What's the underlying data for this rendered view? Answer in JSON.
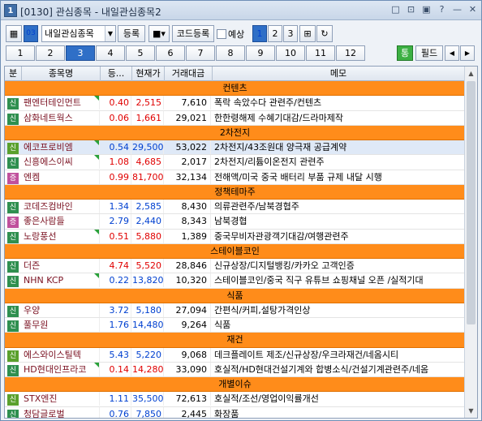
{
  "window": {
    "app_icon": "1",
    "title": "[0130] 관심종목 - 내일관심종목2",
    "controls": [
      "□",
      "⊡",
      "▣",
      "?",
      "—",
      "✕"
    ]
  },
  "toolbar": {
    "combo_label": "내일관심종목",
    "register_label": "등록",
    "code_register_label": "코드등록",
    "checkbox_label": "예상",
    "pages": [
      "1",
      "2",
      "3"
    ],
    "icon_button_label": "03"
  },
  "tabs": {
    "items": [
      "1",
      "2",
      "3",
      "4",
      "5",
      "6",
      "7",
      "8",
      "9",
      "10",
      "11",
      "12"
    ],
    "active_index": 2,
    "green_label": "통",
    "field_label": "필드",
    "prev": "◀",
    "next": "▶"
  },
  "grid": {
    "headers": [
      "분",
      "종목명",
      "등...",
      "현재가",
      "거래대금",
      "메모"
    ],
    "rows": [
      {
        "type": "group",
        "name": "컨텐츠"
      },
      {
        "type": "item",
        "flag": "신",
        "flag_color": "#2f8f4f",
        "name": "팬엔터테인먼트",
        "rate": "0.40",
        "price": "2,515",
        "vol": "7,610",
        "memo": "폭락 속았수다 관련주/컨텐츠",
        "up": true,
        "tri": true
      },
      {
        "type": "item",
        "flag": "신",
        "flag_color": "#2f8f4f",
        "name": "삼화네트웍스",
        "rate": "0.06",
        "price": "1,661",
        "vol": "29,021",
        "memo": "한한령해제 수혜기대감/드라마제작",
        "up": true
      },
      {
        "type": "group",
        "name": "2차전지"
      },
      {
        "type": "item",
        "flag": "신",
        "flag_color": "#5aa02c",
        "name": "에코프로비엠",
        "rate": "0.54",
        "price": "29,500",
        "vol": "53,022",
        "memo": "2차전지/43조원대 양극재 공급계약",
        "up": false,
        "tri": true,
        "sel": true
      },
      {
        "type": "item",
        "flag": "신",
        "flag_color": "#2f8f4f",
        "name": "신흥에스이씨",
        "rate": "1.08",
        "price": "4,685",
        "vol": "2,017",
        "memo": "2차전지/리튬이온전지 관련주",
        "up": true,
        "tri": true
      },
      {
        "type": "item",
        "flag": "증",
        "flag_color": "#c0509c",
        "name": "엔켐",
        "rate": "0.99",
        "price": "81,700",
        "vol": "32,134",
        "memo": "전해액/미국 중국 배터리 부품 규제 내달 시행",
        "up": true
      },
      {
        "type": "group",
        "name": "정책테마주"
      },
      {
        "type": "item",
        "flag": "신",
        "flag_color": "#2f8f4f",
        "name": "코데즈컴바인",
        "rate": "1.34",
        "price": "2,585",
        "vol": "8,430",
        "memo": "의류관련주/남북경협주",
        "up": false
      },
      {
        "type": "item",
        "flag": "증",
        "flag_color": "#c0509c",
        "name": "좋은사람들",
        "rate": "2.79",
        "price": "2,440",
        "vol": "8,343",
        "memo": "남북경협",
        "up": false
      },
      {
        "type": "item",
        "flag": "신",
        "flag_color": "#2f8f4f",
        "name": "노랑풍선",
        "rate": "0.51",
        "price": "5,880",
        "vol": "1,389",
        "memo": "중국무비자관광객기대감/여행관련주",
        "up": true,
        "tri": true
      },
      {
        "type": "group",
        "name": "스테이블코인"
      },
      {
        "type": "item",
        "flag": "신",
        "flag_color": "#2f8f4f",
        "name": "더즌",
        "rate": "4.74",
        "price": "5,520",
        "vol": "28,846",
        "memo": "신규상장/디지털뱅킹/카카오 고객인증",
        "up": true
      },
      {
        "type": "item",
        "flag": "신",
        "flag_color": "#2f8f4f",
        "name": "NHN KCP",
        "rate": "0.22",
        "price": "13,820",
        "vol": "10,320",
        "memo": "스테이블코인/중국 직구 유튜브 쇼핑채널 오픈 /실적기대",
        "up": false,
        "tri": true
      },
      {
        "type": "group",
        "name": "식품"
      },
      {
        "type": "item",
        "flag": "신",
        "flag_color": "#2f8f4f",
        "name": "우양",
        "rate": "3.72",
        "price": "5,180",
        "vol": "27,094",
        "memo": "간편식/커피,설탕가격인상",
        "up": false
      },
      {
        "type": "item",
        "flag": "신",
        "flag_color": "#2f8f4f",
        "name": "풀무원",
        "rate": "1.76",
        "price": "14,480",
        "vol": "9,264",
        "memo": "식품",
        "up": false
      },
      {
        "type": "group",
        "name": "재건"
      },
      {
        "type": "item",
        "flag": "신",
        "flag_color": "#5aa02c",
        "name": "에스와이스틸텍",
        "rate": "5.43",
        "price": "5,220",
        "vol": "9,068",
        "memo": "데크플레이트 제조/신규상장/우크라재건/네옴시티",
        "up": false
      },
      {
        "type": "item",
        "flag": "신",
        "flag_color": "#2f8f4f",
        "name": "HD현대인프라코",
        "rate": "0.14",
        "price": "14,280",
        "vol": "33,090",
        "memo": "호실적/HD현대건설기계와 합병소식/건설기계관련주/네옴",
        "up": true,
        "tri": true
      },
      {
        "type": "group",
        "name": "개별이슈"
      },
      {
        "type": "item",
        "flag": "신",
        "flag_color": "#5aa02c",
        "name": "STX엔진",
        "rate": "1.11",
        "price": "35,500",
        "vol": "72,613",
        "memo": "호실적/조선/영업이익률개선",
        "up": false
      },
      {
        "type": "item",
        "flag": "신",
        "flag_color": "#2f8f4f",
        "name": "청담글로벌",
        "rate": "0.76",
        "price": "7,850",
        "vol": "2,445",
        "memo": "화장품",
        "up": false
      }
    ]
  }
}
